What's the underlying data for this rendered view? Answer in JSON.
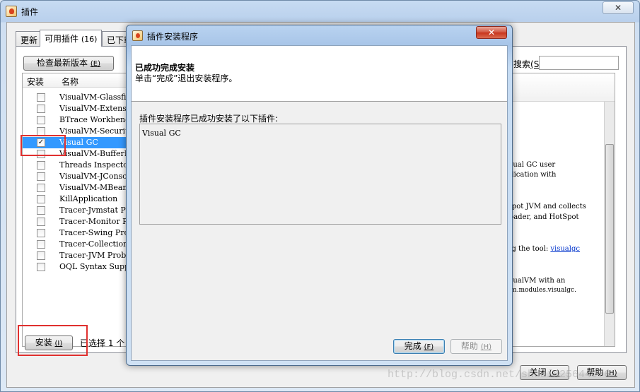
{
  "window": {
    "title": "插件",
    "close_glyph": "✕"
  },
  "tabs": [
    {
      "label": "更新"
    },
    {
      "label": "可用插件",
      "count": "(16)"
    },
    {
      "label": "已下载"
    }
  ],
  "toolbar": {
    "check_button": "检查最新版本",
    "check_mnemonic": "(E)",
    "search_label": "搜索",
    "search_mnemonic": "(S)",
    "search_colon": ":",
    "search_value": ""
  },
  "list": {
    "columns": {
      "install": "安装",
      "name": "名称"
    },
    "items": [
      {
        "label": "VisualVM-Glassfish",
        "checked": false
      },
      {
        "label": "VisualVM-Extensions",
        "checked": false
      },
      {
        "label": "BTrace Workbench",
        "checked": false
      },
      {
        "label": "VisualVM-Security",
        "checked": false
      },
      {
        "label": "Visual GC",
        "checked": true
      },
      {
        "label": "VisualVM-BufferMonitor",
        "checked": false
      },
      {
        "label": "Threads Inspector",
        "checked": false
      },
      {
        "label": "VisualVM-JConsole",
        "checked": false
      },
      {
        "label": "VisualVM-MBeans",
        "checked": false
      },
      {
        "label": "KillApplication",
        "checked": false
      },
      {
        "label": "Tracer-Jvmstat Probes",
        "checked": false
      },
      {
        "label": "Tracer-Monitor Probes",
        "checked": false
      },
      {
        "label": "Tracer-Swing Probes",
        "checked": false
      },
      {
        "label": "Tracer-Collections Probes",
        "checked": false
      },
      {
        "label": "Tracer-JVM Probes",
        "checked": false
      },
      {
        "label": "OQL Syntax Support",
        "checked": false
      }
    ]
  },
  "description": {
    "lines": [
      "isual GC user",
      "plication with",
      "Spot JVM and collects",
      " loader, and HotSpot",
      "ng the tool: ",
      "isualVM with an",
      "vm.modules.visualgc."
    ],
    "link": "visualgc"
  },
  "bottom": {
    "install_button": "安装",
    "install_mnemonic": "(I)",
    "selection_status": "已选择 1 个"
  },
  "footer": {
    "close_button": "关闭",
    "close_mnemonic": "(C)",
    "help_button": "帮助",
    "help_mnemonic": "(H)"
  },
  "dialog": {
    "title": "插件安装程序",
    "close_glyph": "✕",
    "heading": "已成功完成安装",
    "subheading": "单击“完成”退出安装程序。",
    "installed_label": "插件安装程序已成功安装了以下插件:",
    "installed_items": "Visual GC",
    "finish_button": "完成",
    "finish_mnemonic": "(F)",
    "help_button": "帮助",
    "help_mnemonic": "(H)"
  },
  "watermark": "http://blog.csdn.net/shuai825644976"
}
